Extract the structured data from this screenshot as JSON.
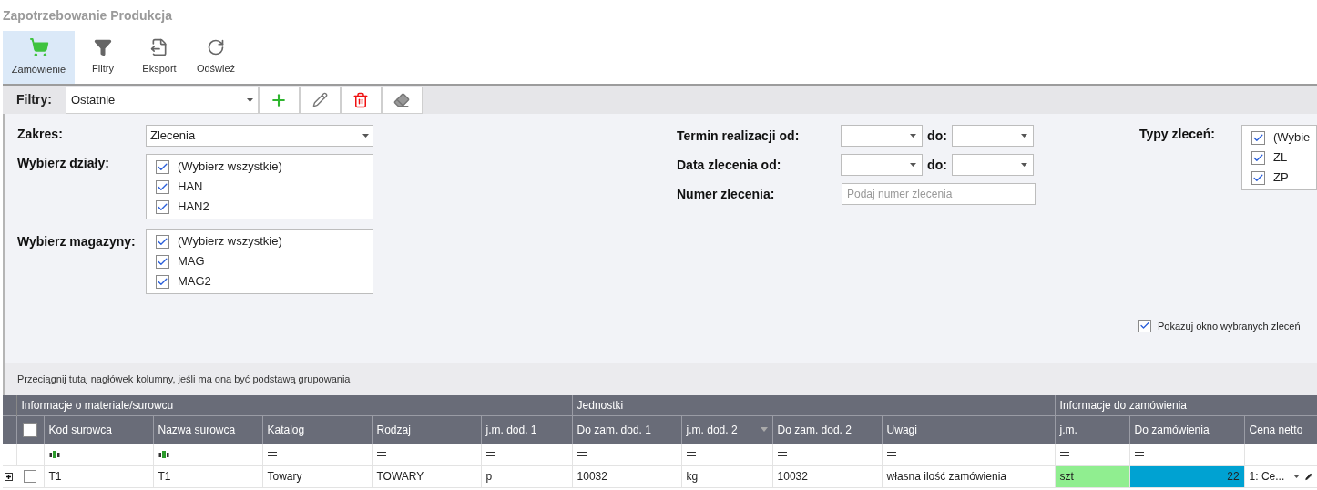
{
  "window": {
    "title": "Zapotrzebowanie Produkcja"
  },
  "toolbar": [
    {
      "label": "Zamówienie",
      "selected": true
    },
    {
      "label": "Filtry",
      "selected": false
    },
    {
      "label": "Eksport",
      "selected": false
    },
    {
      "label": "Odśwież",
      "selected": false
    }
  ],
  "filter_bar": {
    "label": "Filtry:",
    "value": "Ostatnie"
  },
  "form": {
    "zakres": {
      "label": "Zakres:",
      "value": "Zlecenia"
    },
    "dzialy": {
      "label": "Wybierz działy:",
      "items": [
        {
          "label": "(Wybierz wszystkie)",
          "checked": true
        },
        {
          "label": "HAN",
          "checked": true
        },
        {
          "label": "HAN2",
          "checked": true
        }
      ]
    },
    "magazyny": {
      "label": "Wybierz magazyny:",
      "items": [
        {
          "label": "(Wybierz wszystkie)",
          "checked": true
        },
        {
          "label": "MAG",
          "checked": true
        },
        {
          "label": "MAG2",
          "checked": true
        }
      ]
    },
    "termin": {
      "label": "Termin realizacji od:",
      "to_label": "do:"
    },
    "data": {
      "label": "Data zlecenia od:",
      "to_label": "do:"
    },
    "numer": {
      "label": "Numer zlecenia:",
      "placeholder": "Podaj numer zlecenia"
    },
    "typy": {
      "label": "Typy zleceń:",
      "items": [
        {
          "label": "(Wybie",
          "checked": true
        },
        {
          "label": "ZL",
          "checked": true
        },
        {
          "label": "ZP",
          "checked": true
        }
      ]
    },
    "pokazuj": {
      "label": "Pokazuj okno wybranych zleceń",
      "checked": true
    }
  },
  "group_panel": {
    "hint": "Przeciągnij tutaj nagłówek kolumny, jeśli ma ona być podstawą grupowania"
  },
  "table": {
    "header_checked": false,
    "bands": [
      {
        "label": "Informacje o materiale/surowcu"
      },
      {
        "label": "Jednostki"
      },
      {
        "label": "Informacje do zamówienia"
      }
    ],
    "columns": [
      {
        "label": "Kod surowca",
        "kind": "text"
      },
      {
        "label": "Nazwa surowca",
        "kind": "text"
      },
      {
        "label": "Katalog",
        "kind": "equals"
      },
      {
        "label": "Rodzaj",
        "kind": "equals"
      },
      {
        "label": "j.m. dod. 1",
        "kind": "equals"
      },
      {
        "label": "Do zam. dod. 1",
        "kind": "equals"
      },
      {
        "label": "j.m. dod. 2",
        "kind": "equals",
        "sortable": true
      },
      {
        "label": "Do zam. dod. 2",
        "kind": "equals"
      },
      {
        "label": "Uwagi",
        "kind": "equals"
      },
      {
        "label": "j.m.",
        "kind": "equals"
      },
      {
        "label": "Do zamówienia",
        "kind": "equals"
      },
      {
        "label": "Cena netto",
        "kind": "none"
      }
    ],
    "rows": [
      {
        "expanded": false,
        "checked": false,
        "cells": [
          {
            "kind": "text",
            "text": "T1"
          },
          {
            "kind": "text",
            "text": "T1"
          },
          {
            "kind": "text",
            "text": "Towary"
          },
          {
            "kind": "text",
            "text": "TOWARY"
          },
          {
            "kind": "text",
            "text": "p"
          },
          {
            "kind": "text",
            "text": "10032"
          },
          {
            "kind": "text",
            "text": "kg"
          },
          {
            "kind": "text",
            "text": "10032"
          },
          {
            "kind": "text",
            "text": "własna ilość zamówienia"
          },
          {
            "kind": "text",
            "text": "szt",
            "color": "#90ee90"
          },
          {
            "kind": "number",
            "text": "22",
            "color": "#00a2d2"
          },
          {
            "kind": "dropdown",
            "text": "1: Ce..."
          }
        ]
      }
    ]
  }
}
